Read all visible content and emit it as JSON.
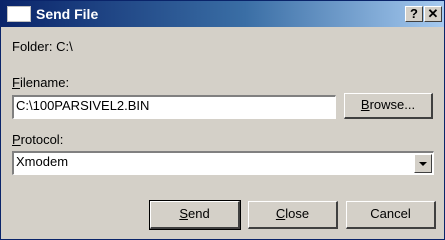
{
  "window": {
    "title": "Send File",
    "help_label": "?",
    "close_label": "✕"
  },
  "folder": {
    "label": "Folder:",
    "value": "C:\\"
  },
  "filename": {
    "label_accel": "F",
    "label_rest": "ilename:",
    "value": "C:\\100PARSIVEL2.BIN",
    "browse_accel": "B",
    "browse_rest": "rowse..."
  },
  "protocol": {
    "label_accel": "P",
    "label_rest": "rotocol:",
    "selected": "Xmodem"
  },
  "buttons": {
    "send_accel": "S",
    "send_rest": "end",
    "close_accel": "C",
    "close_rest": "lose",
    "cancel_label": "Cancel"
  }
}
